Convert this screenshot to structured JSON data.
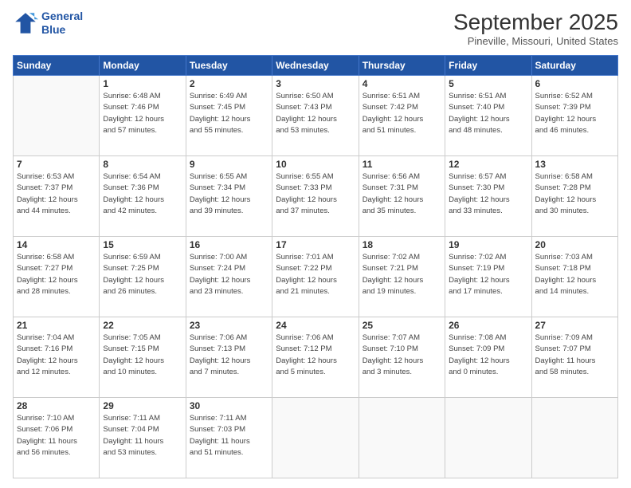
{
  "header": {
    "logo_line1": "General",
    "logo_line2": "Blue",
    "month": "September 2025",
    "location": "Pineville, Missouri, United States"
  },
  "weekdays": [
    "Sunday",
    "Monday",
    "Tuesday",
    "Wednesday",
    "Thursday",
    "Friday",
    "Saturday"
  ],
  "weeks": [
    [
      {
        "day": "",
        "info": ""
      },
      {
        "day": "1",
        "info": "Sunrise: 6:48 AM\nSunset: 7:46 PM\nDaylight: 12 hours\nand 57 minutes."
      },
      {
        "day": "2",
        "info": "Sunrise: 6:49 AM\nSunset: 7:45 PM\nDaylight: 12 hours\nand 55 minutes."
      },
      {
        "day": "3",
        "info": "Sunrise: 6:50 AM\nSunset: 7:43 PM\nDaylight: 12 hours\nand 53 minutes."
      },
      {
        "day": "4",
        "info": "Sunrise: 6:51 AM\nSunset: 7:42 PM\nDaylight: 12 hours\nand 51 minutes."
      },
      {
        "day": "5",
        "info": "Sunrise: 6:51 AM\nSunset: 7:40 PM\nDaylight: 12 hours\nand 48 minutes."
      },
      {
        "day": "6",
        "info": "Sunrise: 6:52 AM\nSunset: 7:39 PM\nDaylight: 12 hours\nand 46 minutes."
      }
    ],
    [
      {
        "day": "7",
        "info": "Sunrise: 6:53 AM\nSunset: 7:37 PM\nDaylight: 12 hours\nand 44 minutes."
      },
      {
        "day": "8",
        "info": "Sunrise: 6:54 AM\nSunset: 7:36 PM\nDaylight: 12 hours\nand 42 minutes."
      },
      {
        "day": "9",
        "info": "Sunrise: 6:55 AM\nSunset: 7:34 PM\nDaylight: 12 hours\nand 39 minutes."
      },
      {
        "day": "10",
        "info": "Sunrise: 6:55 AM\nSunset: 7:33 PM\nDaylight: 12 hours\nand 37 minutes."
      },
      {
        "day": "11",
        "info": "Sunrise: 6:56 AM\nSunset: 7:31 PM\nDaylight: 12 hours\nand 35 minutes."
      },
      {
        "day": "12",
        "info": "Sunrise: 6:57 AM\nSunset: 7:30 PM\nDaylight: 12 hours\nand 33 minutes."
      },
      {
        "day": "13",
        "info": "Sunrise: 6:58 AM\nSunset: 7:28 PM\nDaylight: 12 hours\nand 30 minutes."
      }
    ],
    [
      {
        "day": "14",
        "info": "Sunrise: 6:58 AM\nSunset: 7:27 PM\nDaylight: 12 hours\nand 28 minutes."
      },
      {
        "day": "15",
        "info": "Sunrise: 6:59 AM\nSunset: 7:25 PM\nDaylight: 12 hours\nand 26 minutes."
      },
      {
        "day": "16",
        "info": "Sunrise: 7:00 AM\nSunset: 7:24 PM\nDaylight: 12 hours\nand 23 minutes."
      },
      {
        "day": "17",
        "info": "Sunrise: 7:01 AM\nSunset: 7:22 PM\nDaylight: 12 hours\nand 21 minutes."
      },
      {
        "day": "18",
        "info": "Sunrise: 7:02 AM\nSunset: 7:21 PM\nDaylight: 12 hours\nand 19 minutes."
      },
      {
        "day": "19",
        "info": "Sunrise: 7:02 AM\nSunset: 7:19 PM\nDaylight: 12 hours\nand 17 minutes."
      },
      {
        "day": "20",
        "info": "Sunrise: 7:03 AM\nSunset: 7:18 PM\nDaylight: 12 hours\nand 14 minutes."
      }
    ],
    [
      {
        "day": "21",
        "info": "Sunrise: 7:04 AM\nSunset: 7:16 PM\nDaylight: 12 hours\nand 12 minutes."
      },
      {
        "day": "22",
        "info": "Sunrise: 7:05 AM\nSunset: 7:15 PM\nDaylight: 12 hours\nand 10 minutes."
      },
      {
        "day": "23",
        "info": "Sunrise: 7:06 AM\nSunset: 7:13 PM\nDaylight: 12 hours\nand 7 minutes."
      },
      {
        "day": "24",
        "info": "Sunrise: 7:06 AM\nSunset: 7:12 PM\nDaylight: 12 hours\nand 5 minutes."
      },
      {
        "day": "25",
        "info": "Sunrise: 7:07 AM\nSunset: 7:10 PM\nDaylight: 12 hours\nand 3 minutes."
      },
      {
        "day": "26",
        "info": "Sunrise: 7:08 AM\nSunset: 7:09 PM\nDaylight: 12 hours\nand 0 minutes."
      },
      {
        "day": "27",
        "info": "Sunrise: 7:09 AM\nSunset: 7:07 PM\nDaylight: 11 hours\nand 58 minutes."
      }
    ],
    [
      {
        "day": "28",
        "info": "Sunrise: 7:10 AM\nSunset: 7:06 PM\nDaylight: 11 hours\nand 56 minutes."
      },
      {
        "day": "29",
        "info": "Sunrise: 7:11 AM\nSunset: 7:04 PM\nDaylight: 11 hours\nand 53 minutes."
      },
      {
        "day": "30",
        "info": "Sunrise: 7:11 AM\nSunset: 7:03 PM\nDaylight: 11 hours\nand 51 minutes."
      },
      {
        "day": "",
        "info": ""
      },
      {
        "day": "",
        "info": ""
      },
      {
        "day": "",
        "info": ""
      },
      {
        "day": "",
        "info": ""
      }
    ]
  ]
}
